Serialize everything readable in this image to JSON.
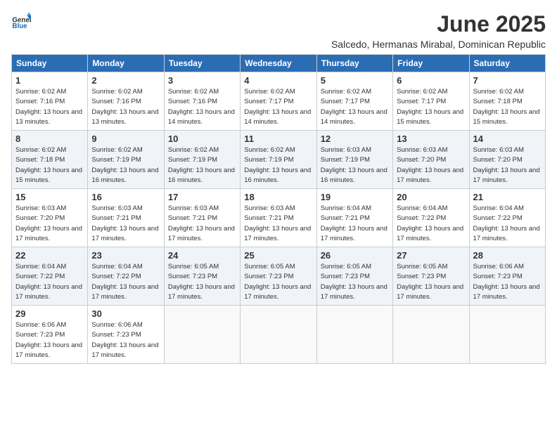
{
  "logo": {
    "general": "General",
    "blue": "Blue"
  },
  "title": "June 2025",
  "subtitle": "Salcedo, Hermanas Mirabal, Dominican Republic",
  "headers": [
    "Sunday",
    "Monday",
    "Tuesday",
    "Wednesday",
    "Thursday",
    "Friday",
    "Saturday"
  ],
  "weeks": [
    [
      {
        "day": "1",
        "sunrise": "6:02 AM",
        "sunset": "7:16 PM",
        "daylight": "13 hours and 13 minutes."
      },
      {
        "day": "2",
        "sunrise": "6:02 AM",
        "sunset": "7:16 PM",
        "daylight": "13 hours and 13 minutes."
      },
      {
        "day": "3",
        "sunrise": "6:02 AM",
        "sunset": "7:16 PM",
        "daylight": "13 hours and 14 minutes."
      },
      {
        "day": "4",
        "sunrise": "6:02 AM",
        "sunset": "7:17 PM",
        "daylight": "13 hours and 14 minutes."
      },
      {
        "day": "5",
        "sunrise": "6:02 AM",
        "sunset": "7:17 PM",
        "daylight": "13 hours and 14 minutes."
      },
      {
        "day": "6",
        "sunrise": "6:02 AM",
        "sunset": "7:17 PM",
        "daylight": "13 hours and 15 minutes."
      },
      {
        "day": "7",
        "sunrise": "6:02 AM",
        "sunset": "7:18 PM",
        "daylight": "13 hours and 15 minutes."
      }
    ],
    [
      {
        "day": "8",
        "sunrise": "6:02 AM",
        "sunset": "7:18 PM",
        "daylight": "13 hours and 15 minutes."
      },
      {
        "day": "9",
        "sunrise": "6:02 AM",
        "sunset": "7:19 PM",
        "daylight": "13 hours and 16 minutes."
      },
      {
        "day": "10",
        "sunrise": "6:02 AM",
        "sunset": "7:19 PM",
        "daylight": "13 hours and 16 minutes."
      },
      {
        "day": "11",
        "sunrise": "6:02 AM",
        "sunset": "7:19 PM",
        "daylight": "13 hours and 16 minutes."
      },
      {
        "day": "12",
        "sunrise": "6:03 AM",
        "sunset": "7:19 PM",
        "daylight": "13 hours and 16 minutes."
      },
      {
        "day": "13",
        "sunrise": "6:03 AM",
        "sunset": "7:20 PM",
        "daylight": "13 hours and 17 minutes."
      },
      {
        "day": "14",
        "sunrise": "6:03 AM",
        "sunset": "7:20 PM",
        "daylight": "13 hours and 17 minutes."
      }
    ],
    [
      {
        "day": "15",
        "sunrise": "6:03 AM",
        "sunset": "7:20 PM",
        "daylight": "13 hours and 17 minutes."
      },
      {
        "day": "16",
        "sunrise": "6:03 AM",
        "sunset": "7:21 PM",
        "daylight": "13 hours and 17 minutes."
      },
      {
        "day": "17",
        "sunrise": "6:03 AM",
        "sunset": "7:21 PM",
        "daylight": "13 hours and 17 minutes."
      },
      {
        "day": "18",
        "sunrise": "6:03 AM",
        "sunset": "7:21 PM",
        "daylight": "13 hours and 17 minutes."
      },
      {
        "day": "19",
        "sunrise": "6:04 AM",
        "sunset": "7:21 PM",
        "daylight": "13 hours and 17 minutes."
      },
      {
        "day": "20",
        "sunrise": "6:04 AM",
        "sunset": "7:22 PM",
        "daylight": "13 hours and 17 minutes."
      },
      {
        "day": "21",
        "sunrise": "6:04 AM",
        "sunset": "7:22 PM",
        "daylight": "13 hours and 17 minutes."
      }
    ],
    [
      {
        "day": "22",
        "sunrise": "6:04 AM",
        "sunset": "7:22 PM",
        "daylight": "13 hours and 17 minutes."
      },
      {
        "day": "23",
        "sunrise": "6:04 AM",
        "sunset": "7:22 PM",
        "daylight": "13 hours and 17 minutes."
      },
      {
        "day": "24",
        "sunrise": "6:05 AM",
        "sunset": "7:23 PM",
        "daylight": "13 hours and 17 minutes."
      },
      {
        "day": "25",
        "sunrise": "6:05 AM",
        "sunset": "7:23 PM",
        "daylight": "13 hours and 17 minutes."
      },
      {
        "day": "26",
        "sunrise": "6:05 AM",
        "sunset": "7:23 PM",
        "daylight": "13 hours and 17 minutes."
      },
      {
        "day": "27",
        "sunrise": "6:05 AM",
        "sunset": "7:23 PM",
        "daylight": "13 hours and 17 minutes."
      },
      {
        "day": "28",
        "sunrise": "6:06 AM",
        "sunset": "7:23 PM",
        "daylight": "13 hours and 17 minutes."
      }
    ],
    [
      {
        "day": "29",
        "sunrise": "6:06 AM",
        "sunset": "7:23 PM",
        "daylight": "13 hours and 17 minutes."
      },
      {
        "day": "30",
        "sunrise": "6:06 AM",
        "sunset": "7:23 PM",
        "daylight": "13 hours and 17 minutes."
      },
      null,
      null,
      null,
      null,
      null
    ]
  ]
}
